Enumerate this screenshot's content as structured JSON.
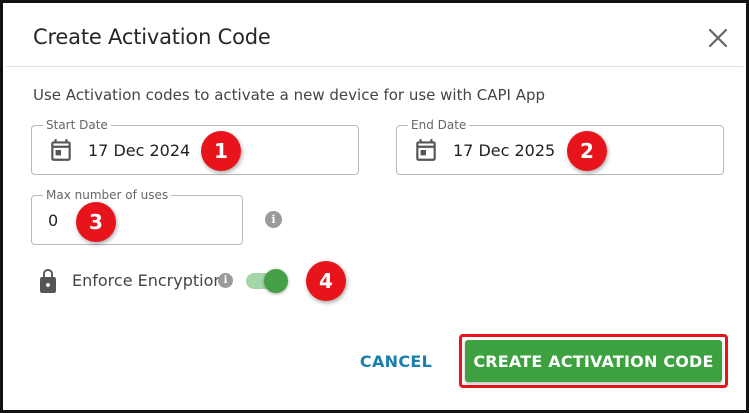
{
  "dialog": {
    "title": "Create Activation Code",
    "description": "Use Activation codes to activate a new device for use with CAPI App"
  },
  "start_date": {
    "label": "Start Date",
    "value": "17 Dec 2024",
    "icon": "calendar-icon"
  },
  "end_date": {
    "label": "End Date",
    "value": "17 Dec 2025",
    "icon": "calendar-icon"
  },
  "max_uses": {
    "label": "Max number of uses",
    "value": "0"
  },
  "encryption": {
    "label": "Enforce Encryption",
    "enabled": true,
    "icon": "lock-icon"
  },
  "info_glyph": "i",
  "annotations": [
    "1",
    "2",
    "3",
    "4"
  ],
  "buttons": {
    "cancel": "CANCEL",
    "create": "CREATE ACTIVATION CODE"
  },
  "colors": {
    "primary_green": "#3da13f",
    "toggle_track": "#a5d6a7",
    "toggle_thumb": "#43a047",
    "cancel_blue": "#1a7fae",
    "annotation_red": "#e8141c"
  }
}
